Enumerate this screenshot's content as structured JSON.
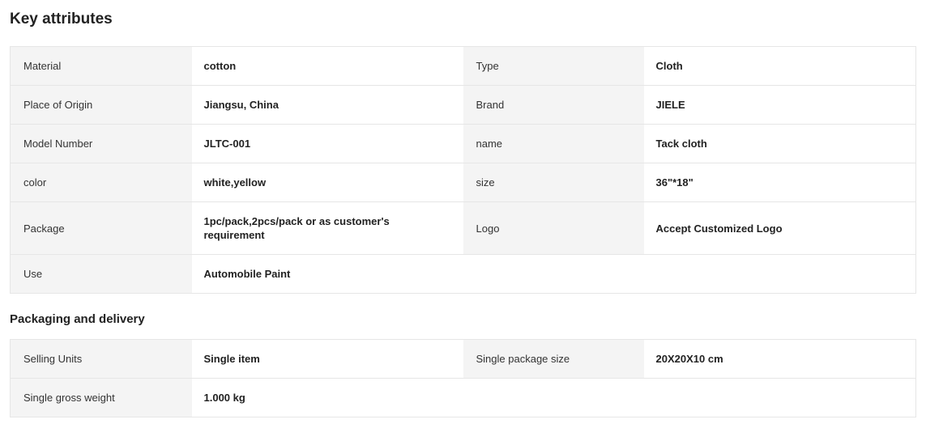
{
  "key_attributes": {
    "title": "Key attributes",
    "rows": [
      {
        "label1": "Material",
        "value1": "cotton",
        "label2": "Type",
        "value2": "Cloth"
      },
      {
        "label1": "Place of Origin",
        "value1": "Jiangsu, China",
        "label2": "Brand",
        "value2": "JIELE"
      },
      {
        "label1": "Model Number",
        "value1": "JLTC-001",
        "label2": "name",
        "value2": "Tack cloth"
      },
      {
        "label1": "color",
        "value1": "white,yellow",
        "label2": "size",
        "value2": "36\"*18\""
      },
      {
        "label1": "Package",
        "value1": "1pc/pack,2pcs/pack or as customer's requirement",
        "label2": "Logo",
        "value2": "Accept Customized Logo"
      },
      {
        "label1": "Use",
        "value1": "Automobile Paint"
      }
    ]
  },
  "packaging": {
    "title": "Packaging and delivery",
    "rows": [
      {
        "label1": "Selling Units",
        "value1": "Single item",
        "label2": "Single package size",
        "value2": "20X20X10 cm"
      },
      {
        "label1": "Single gross weight",
        "value1": "1.000 kg"
      }
    ]
  }
}
